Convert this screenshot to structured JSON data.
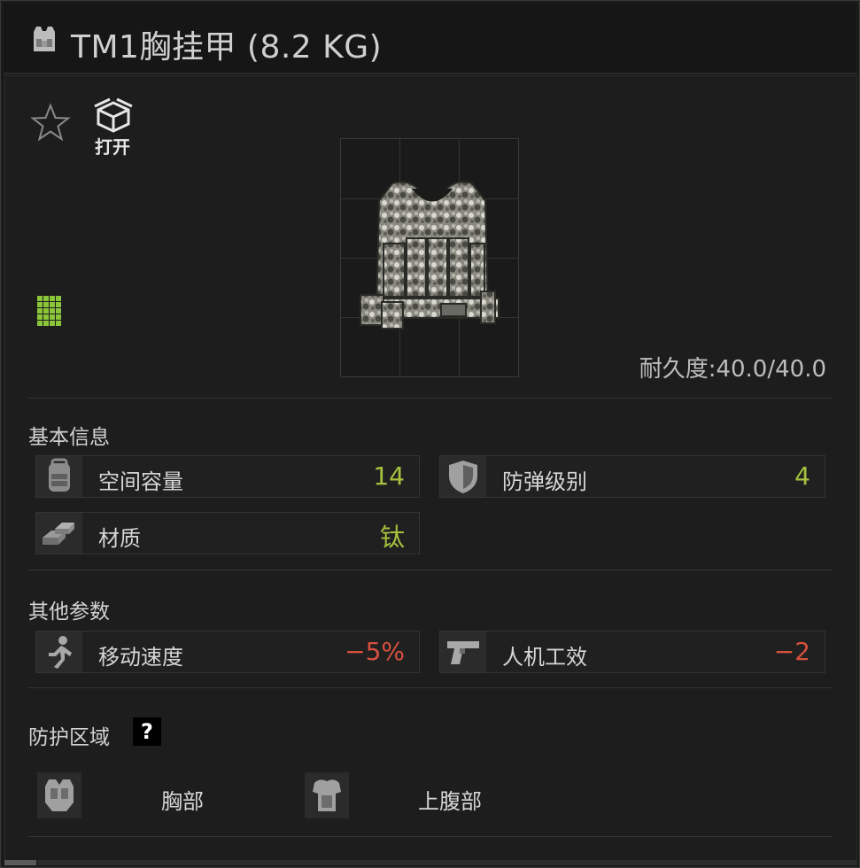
{
  "window": {
    "title": "TM1胸挂甲 (8.2 KG)"
  },
  "actions": {
    "open_label": "打开"
  },
  "item": {
    "durability_label": "耐久度:",
    "durability_value": "40.0/40.0"
  },
  "sections": {
    "basic_title": "基本信息",
    "other_title": "其他参数",
    "protection_title": "防护区域",
    "help_label": "?"
  },
  "basic_stats": [
    {
      "icon": "backpack-icon",
      "label": "空间容量",
      "value": "14"
    },
    {
      "icon": "shield-icon",
      "label": "防弹级别",
      "value": "4"
    },
    {
      "icon": "material-ingots-icon",
      "label": "材质",
      "value": "钛"
    }
  ],
  "other_stats": [
    {
      "icon": "running-figure-icon",
      "label": "移动速度",
      "value": "−5%"
    },
    {
      "icon": "pistol-icon",
      "label": "人机工效",
      "value": "−2"
    }
  ],
  "protection_zones": [
    {
      "icon": "chest-armor-icon",
      "label": "胸部"
    },
    {
      "icon": "abdomen-armor-icon",
      "label": "上腹部"
    }
  ],
  "colors": {
    "positive": "#a5c23e",
    "negative": "#d6503d",
    "grid_icon": "#8ac53a"
  }
}
